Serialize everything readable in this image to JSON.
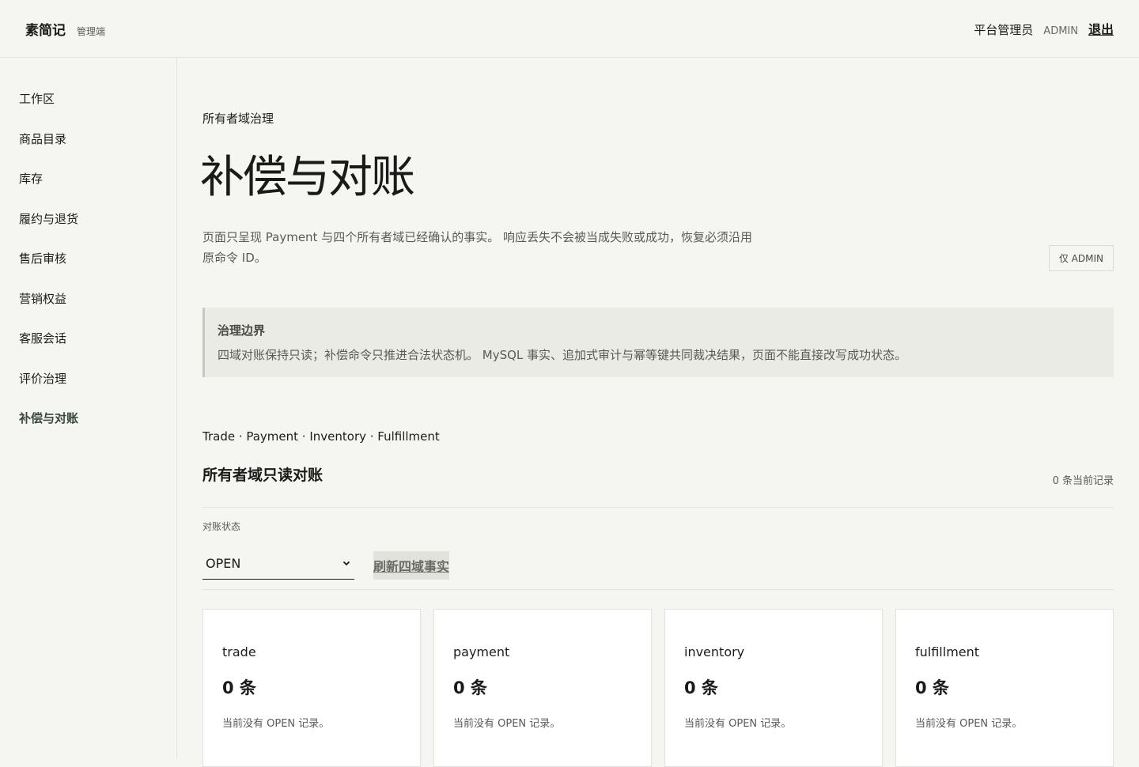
{
  "header": {
    "brand": "素简记",
    "brand_sub": "管理端",
    "role": "平台管理员",
    "username": "ADMIN",
    "logout": "退出"
  },
  "sidebar": {
    "items": [
      {
        "label": "工作区",
        "active": false
      },
      {
        "label": "商品目录",
        "active": false
      },
      {
        "label": "库存",
        "active": false
      },
      {
        "label": "履约与退货",
        "active": false
      },
      {
        "label": "售后审核",
        "active": false
      },
      {
        "label": "营销权益",
        "active": false
      },
      {
        "label": "客服会话",
        "active": false
      },
      {
        "label": "评价治理",
        "active": false
      },
      {
        "label": "补偿与对账",
        "active": true
      }
    ]
  },
  "main": {
    "eyebrow": "所有者域治理",
    "title": "补偿与对账",
    "desc_line1": "页面只呈现 Payment 与四个所有者域已经确认的事实。 响应丢失不会被当成失败或成功，恢复必须沿用",
    "desc_line2": "原命令 ID。",
    "admin_badge": "仅 ADMIN",
    "callout": {
      "title": "治理边界",
      "body": "四域对账保持只读；补偿命令只推进合法状态机。 MySQL 事实、追加式审计与幂等键共同裁决结果，页面不能直接改写成功状态。"
    },
    "domain_trail": "Trade · Payment · Inventory · Fulfillment",
    "section_title": "所有者域只读对账",
    "record_count": "0 条当前记录",
    "filter": {
      "label": "对账状态",
      "value": "OPEN"
    },
    "refresh_button": "刷新四域事实",
    "cards": [
      {
        "name": "trade",
        "count": "0 条",
        "empty": "当前没有 OPEN 记录。"
      },
      {
        "name": "payment",
        "count": "0 条",
        "empty": "当前没有 OPEN 记录。"
      },
      {
        "name": "inventory",
        "count": "0 条",
        "empty": "当前没有 OPEN 记录。"
      },
      {
        "name": "fulfillment",
        "count": "0 条",
        "empty": "当前没有 OPEN 记录。"
      }
    ]
  }
}
